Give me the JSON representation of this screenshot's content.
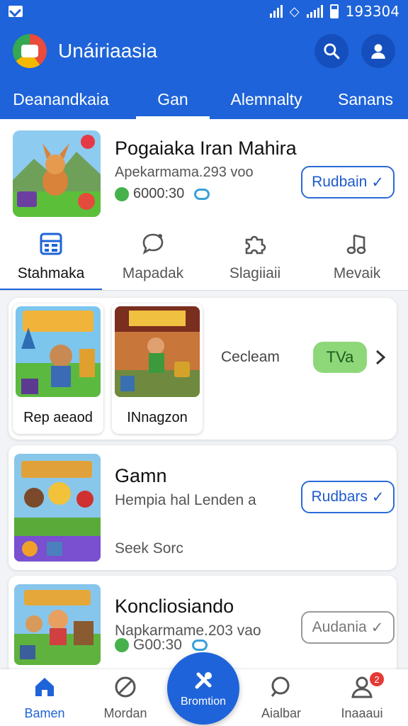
{
  "status_bar": {
    "time": "193304"
  },
  "app_bar": {
    "title": "Unáiriaasia"
  },
  "top_tabs": [
    {
      "label": "Deanandkaia"
    },
    {
      "label": "Gan"
    },
    {
      "label": "Alemnalty"
    },
    {
      "label": "Sanans"
    }
  ],
  "featured": {
    "title": "Pogaiaka Iran Mahira",
    "subtitle": "Apekarmama.293 voo",
    "meta": "6000:30",
    "button_label": "Rudbain"
  },
  "category_tabs": [
    {
      "label": "Stahmaka",
      "icon": "grid-icon"
    },
    {
      "label": "Mapadak",
      "icon": "chat-bubble-icon"
    },
    {
      "label": "Slagiiaii",
      "icon": "puzzle-icon"
    },
    {
      "label": "Mevaik",
      "icon": "music-note-icon"
    }
  ],
  "carousel": {
    "items": [
      {
        "caption": "Rep aeaod"
      },
      {
        "caption": "INnagzon"
      }
    ],
    "label": "Cecleam",
    "pill_label": "TVa"
  },
  "games": [
    {
      "title": "Gamn",
      "subtitle": "Hempia hal Lenden a",
      "meta": "Seek Sorc",
      "button_label": "Rudbars",
      "button_style": "primary"
    },
    {
      "title": "Koncliosiando",
      "subtitle": "Napkarmame.203 vao",
      "meta": "G00:30",
      "button_label": "Audania",
      "button_style": "disabled"
    }
  ],
  "bottom_nav": [
    {
      "label": "Bamen",
      "icon": "home-icon"
    },
    {
      "label": "Mordan",
      "icon": "block-icon"
    },
    {
      "label": "Bromtion",
      "icon": "tools-icon"
    },
    {
      "label": "Aialbar",
      "icon": "search-icon"
    },
    {
      "label": "Inaaaui",
      "icon": "profile-icon",
      "badge": "2"
    }
  ],
  "colors": {
    "primary": "#1e63d9",
    "accent_green": "#8fd87a",
    "badge": "#e53935"
  }
}
